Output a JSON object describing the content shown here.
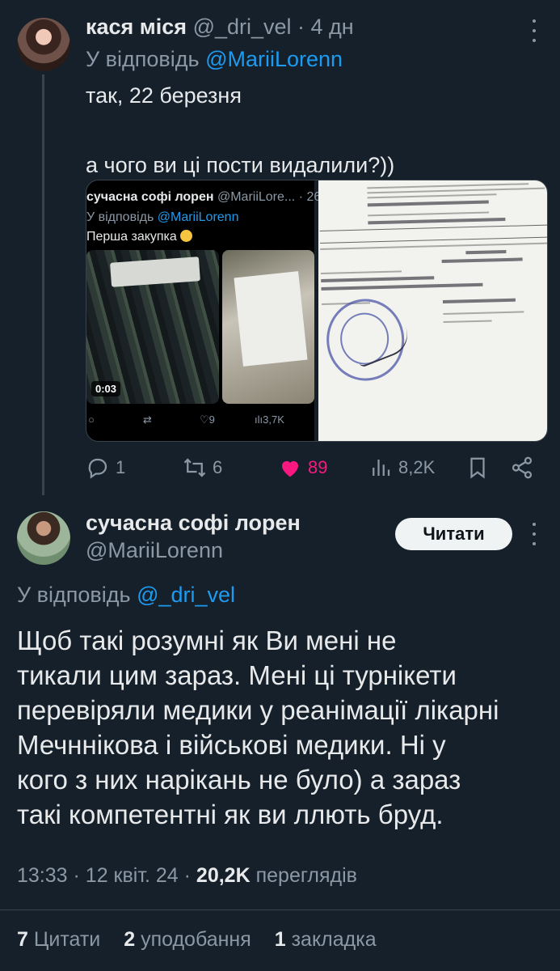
{
  "reply_tweet": {
    "author_name": "кася міся",
    "author_handle": "@_dri_vel",
    "time_ago": "· 4 дн",
    "replying_prefix": "У відповідь",
    "replying_to": "@MariiLorenn",
    "text_line1": "так, 22 березня",
    "text_line2": "а чого ви ці пости видалили?))",
    "embedded_post": {
      "author_name": "сучасна софі лорен",
      "author_handle": "@MariiLore...",
      "time": "· 26",
      "replying_prefix": "У відповідь",
      "replying_to": "@MariiLorenn",
      "text": "Перша закупка",
      "video_duration": "0:03",
      "likes": "9",
      "views": "3,7K"
    },
    "document_image": {
      "header": "Товариство з обмеженою відповідальністю \"ДНІПРО ТМТ\"",
      "seller_line": "Лінник Марік Олександрівна Фізична особа",
      "contract": "Замовлення покупця № 335 від 21 березня 2024 р.",
      "col_goods": "Товар",
      "col_qty": "Кількість",
      "row_item": "Джгут кровоспинний \"ДНІПРО\"",
      "total_label": "Разом:",
      "vat_label": "У тому числі ПДВ 7 %:",
      "sum_line": "Всього на суму 27 000,00 грн.",
      "sum_words1": "Двадцять сім тисяч гривень 00 копійок",
      "sum_words2": "Одна тисяча сімсот шістдесят шість гривень 36 копійок",
      "received": "Отримав(ла)",
      "signer": "Лінник Марік Олександрівна",
      "by_proxy": "За довіреністю",
      "no": "№",
      "issued": "Виписав(ла)"
    },
    "stats": {
      "replies": "1",
      "retweets": "6",
      "likes": "89",
      "views": "8,2K"
    }
  },
  "main_tweet": {
    "author_name": "сучасна софі лорен",
    "author_handle": "@MariiLorenn",
    "follow_label": "Читати",
    "replying_prefix": "У відповідь",
    "replying_to": "@_dri_vel",
    "body_lines": [
      "Щоб такі розумні як Ви мені не",
      "тикали цим зараз. Мені ці турнікети",
      "перевіряли медики у реанімації лікарні",
      "Мечннікова і військові медики. Ні у",
      "кого з них нарікань не було) а зараз",
      "такі компетентні як ви ллють бруд."
    ],
    "time": "13:33",
    "date": "· 12 квіт. 24 ·",
    "views_count": "20,2K",
    "views_label": "переглядів",
    "quotes_count": "7",
    "quotes_label": "Цитати",
    "likes_count": "2",
    "likes_label": "уподобання",
    "bookmarks_count": "1",
    "bookmarks_label": "закладка"
  },
  "colors": {
    "background": "#15202b",
    "text": "#e7e9ea",
    "muted": "#8b98a5",
    "link": "#1d9bf0",
    "like": "#f91880"
  }
}
